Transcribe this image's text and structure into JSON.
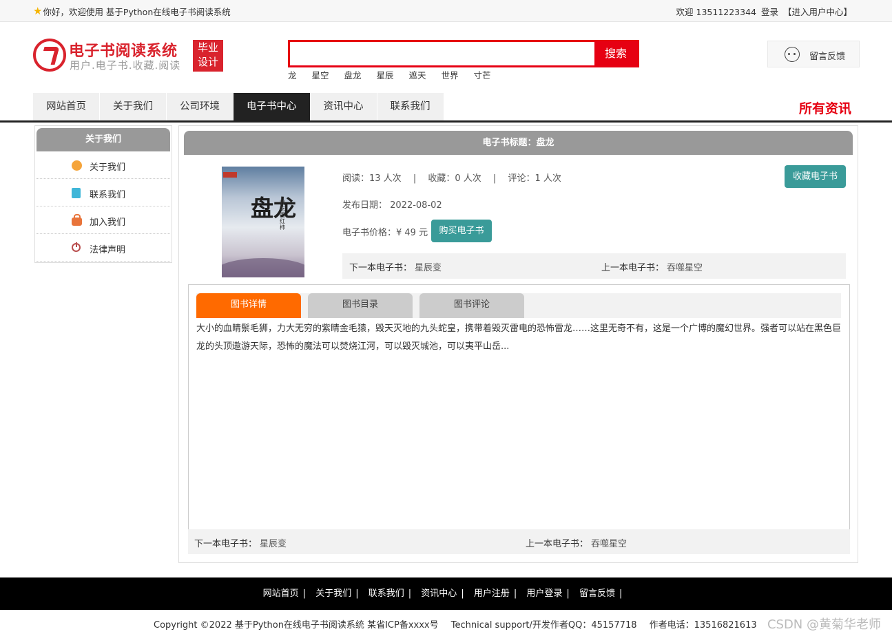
{
  "topbar": {
    "welcome": "你好，欢迎使用 基于Python在线电子书阅读系统",
    "user_welcome": "欢迎 13511223344",
    "login": "登录",
    "user_center": "【进入用户中心】"
  },
  "header": {
    "logo_title": "电子书阅读系统",
    "logo_subtitle": "用户.电子书.收藏.阅读",
    "badge_line1": "毕业",
    "badge_line2": "设计",
    "search_placeholder": "",
    "search_button": "搜索",
    "hot_words": [
      "龙",
      "星空",
      "盘龙",
      "星辰",
      "遮天",
      "世界",
      "寸芒"
    ],
    "feedback": "留言反馈"
  },
  "nav": {
    "items": [
      "网站首页",
      "关于我们",
      "公司环境",
      "电子书中心",
      "资讯中心",
      "联系我们"
    ],
    "active_index": 3,
    "right_title": "所有资讯"
  },
  "sidebar": {
    "title": "关于我们",
    "items": [
      {
        "label": "关于我们",
        "icon": "coin-icon"
      },
      {
        "label": "联系我们",
        "icon": "clipboard-icon"
      },
      {
        "label": "加入我们",
        "icon": "lock-icon"
      },
      {
        "label": "法律声明",
        "icon": "power-icon"
      }
    ]
  },
  "book": {
    "header": "电子书标题：盘龙",
    "cover_title": "盘龙",
    "cover_author": "我吃西红柿",
    "read_count": "阅读：13 人次",
    "fav_count": "收藏：0 人次",
    "comment_count": "评论：1 人次",
    "sep": "|",
    "publish_date": "发布日期： 2022-08-02",
    "price": "电子书价格：¥ 49 元",
    "buy_button": "购买电子书",
    "fav_button": "收藏电子书",
    "next_label": "下一本电子书：",
    "next_value": "星辰变",
    "prev_label": "上一本电子书：",
    "prev_value": "吞噬星空"
  },
  "tabs": {
    "items": [
      "图书详情",
      "图书目录",
      "图书评论"
    ],
    "active_index": 0,
    "description": "大小的血睛鬃毛狮，力大无穷的紫睛金毛猿，毁天灭地的九头蛇皇，携带着毁灭雷电的恐怖雷龙……这里无奇不有，这是一个广博的魔幻世界。强者可以站在黑色巨龙的头顶遨游天际，恐怖的魔法可以焚烧江河，可以毁灭城池，可以夷平山岳..."
  },
  "footer": {
    "nav": [
      "网站首页",
      "关于我们",
      "联系我们",
      "资讯中心",
      "用户注册",
      "用户登录",
      "留言反馈"
    ],
    "bar": "|",
    "copyright": "Copyright ©2022 基于Python在线电子书阅读系统 某省ICP备xxxx号",
    "support": "Technical support/开发作者QQ：45157718",
    "phone": "作者电话：13516821613",
    "watermark": "CSDN @黄菊华老师"
  },
  "colors": {
    "brand_red": "#d9232d",
    "search_red": "#e60012",
    "teal": "#3a9b99",
    "tab_orange": "#ff6a00",
    "nav_dark": "#222222"
  }
}
